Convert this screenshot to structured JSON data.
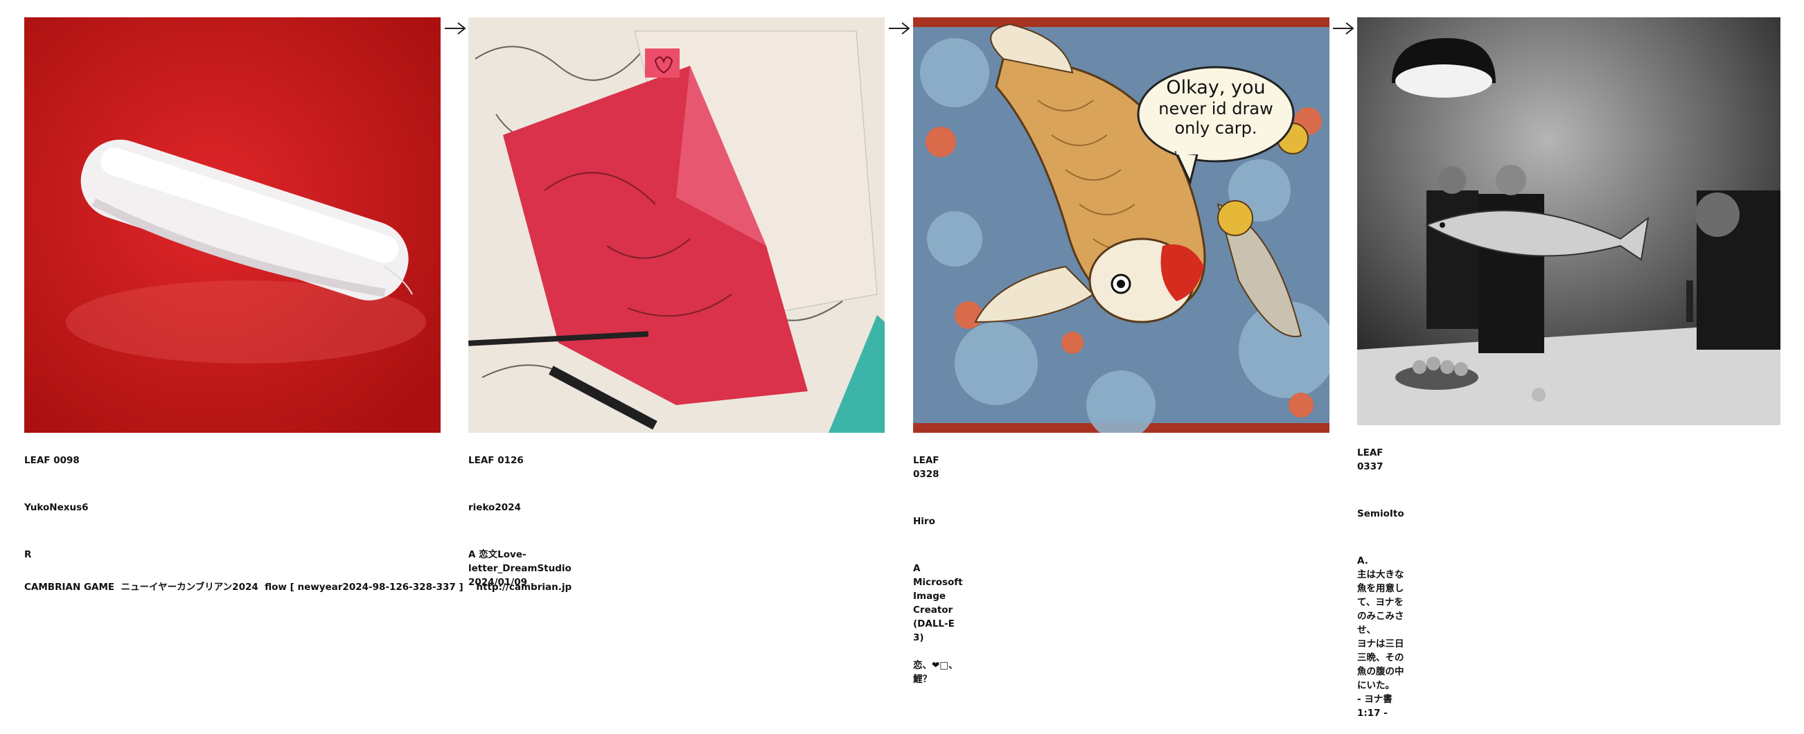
{
  "leaves": [
    {
      "leaf": "LEAF 0098",
      "user": "YukoNexus6",
      "body": "R"
    },
    {
      "leaf": "LEAF 0126",
      "user": "rieko2024",
      "body": "A 恋文Love-letter_DreamStudio\n2024/01/09"
    },
    {
      "leaf": "LEAF 0328",
      "user": "Hiro",
      "body": "A\nMicrosoft Image Creator (DALL-E 3)\n\n恋、❤□、鯉？"
    },
    {
      "leaf": "LEAF 0337",
      "user": "SemioIto",
      "body": "A.\n主は大きな魚を用意して、ヨナをのみこみさせ、\nヨナは三日三晩、その魚の腹の中にいた。\n- ヨナ書 1:17 -"
    }
  ],
  "speech_bubble": {
    "line1": "Olkay, you",
    "line2": "never id draw",
    "line3": "only carp."
  },
  "footer": {
    "text": "CAMBRIAN GAME  ニューイヤーカンブリアン2024  flow [ newyear2024-98-126-328-337 ]    http://cambrian.jp"
  },
  "colors": {
    "red": "#c8151b",
    "pink": "#e04a5c",
    "teal": "#3cb5a8"
  }
}
